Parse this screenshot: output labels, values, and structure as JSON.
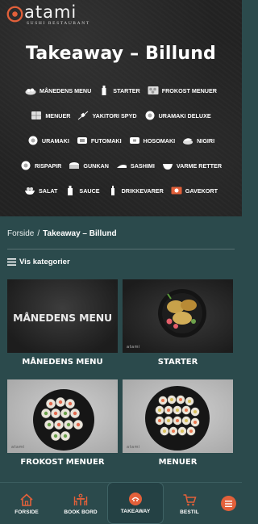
{
  "brand": {
    "name": "atami",
    "tagline": "SUSHI RESTAURANT"
  },
  "hero": {
    "title": "Takeaway – Billund"
  },
  "categories": [
    [
      {
        "label": "MÅNEDENS MENU",
        "icon": "platter-icon"
      },
      {
        "label": "STARTER",
        "icon": "bottle-icon"
      },
      {
        "label": "FROKOST MENUER",
        "icon": "tray-icon"
      }
    ],
    [
      {
        "label": "MENUER",
        "icon": "box-icon"
      },
      {
        "label": "YAKITORI SPYD",
        "icon": "skewer-icon"
      },
      {
        "label": "URAMAKI DELUXE",
        "icon": "roll-icon"
      }
    ],
    [
      {
        "label": "URAMAKI",
        "icon": "roll-icon"
      },
      {
        "label": "FUTOMAKI",
        "icon": "maki-icon"
      },
      {
        "label": "HOSOMAKI",
        "icon": "maki-icon"
      },
      {
        "label": "NIGIRI",
        "icon": "nigiri-icon"
      }
    ],
    [
      {
        "label": "RISPAPIR",
        "icon": "roll-icon"
      },
      {
        "label": "GUNKAN",
        "icon": "gunkan-icon"
      },
      {
        "label": "SASHIMI",
        "icon": "sashimi-icon"
      },
      {
        "label": "VARME RETTER",
        "icon": "bowl-icon"
      }
    ],
    [
      {
        "label": "SALAT",
        "icon": "salad-icon"
      },
      {
        "label": "SAUCE",
        "icon": "sauce-icon"
      },
      {
        "label": "DRIKKEVARER",
        "icon": "bottle-icon"
      },
      {
        "label": "GAVEKORT",
        "icon": "giftcard-icon"
      }
    ]
  ],
  "breadcrumb": {
    "home": "Forside",
    "separator": "/",
    "current": "Takeaway – Billund"
  },
  "vis_kategorier": "Vis kategorier",
  "cards": [
    {
      "label": "MÅNEDENS MENU",
      "image_text": "MÅNEDENS MENU"
    },
    {
      "label": "STARTER"
    },
    {
      "label": "FROKOST MENUER"
    },
    {
      "label": "MENUER"
    }
  ],
  "bottom_nav": [
    {
      "label": "FORSIDE",
      "icon": "home-icon"
    },
    {
      "label": "BOOK BORD",
      "icon": "table-icon"
    },
    {
      "label": "TAKEAWAY",
      "icon": "takeaway-icon",
      "active": true
    },
    {
      "label": "BESTIL",
      "icon": "cart-icon"
    }
  ],
  "colors": {
    "background": "#2b4a4c",
    "accent": "#e2603a",
    "hero_bg": "#232323"
  }
}
